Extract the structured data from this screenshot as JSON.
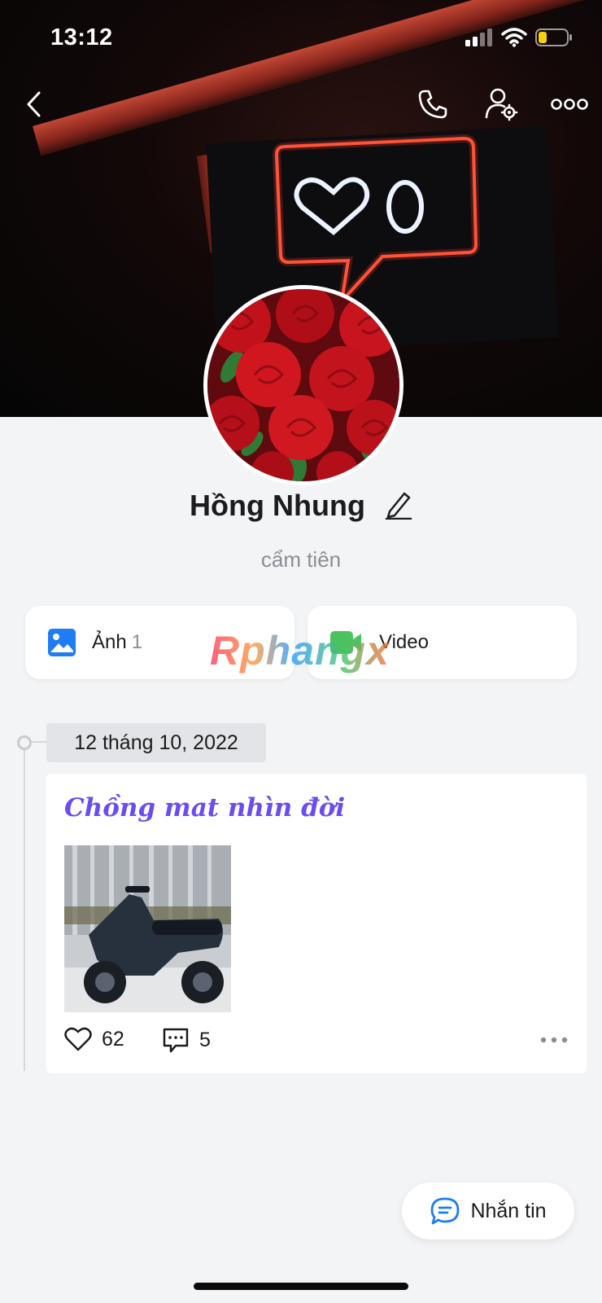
{
  "status_bar": {
    "time": "13:12"
  },
  "icons": {
    "back": "chevron-left-icon",
    "call": "phone-icon",
    "settings": "user-settings-icon",
    "more": "more-horizontal-icon",
    "edit": "pencil-icon",
    "photos": "image-icon",
    "video": "video-camera-icon",
    "like": "heart-icon",
    "comment": "comment-icon",
    "message": "chat-bubble-icon"
  },
  "profile": {
    "name": "Hồng Nhung",
    "subtitle": "cẩm tiên"
  },
  "media_tabs": {
    "photos_label": "Ảnh",
    "photos_count": "1",
    "video_label": "Video"
  },
  "watermark": {
    "text": "Rphangx"
  },
  "timeline": {
    "date": "12 tháng 10, 2022",
    "post": {
      "title": "Chồng mat nhìn đời",
      "likes": "62",
      "comments": "5"
    }
  },
  "message_button": {
    "label": "Nhắn tin"
  },
  "colors": {
    "accent_blue": "#1f7cf3",
    "post_title_purple": "#6c4cf0",
    "video_green": "#4cc15f",
    "background": "#f3f4f6"
  }
}
